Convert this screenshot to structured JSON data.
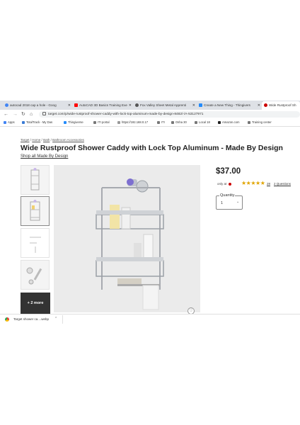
{
  "browser": {
    "tabs": [
      {
        "label": "autocad 2018 cap a hole - Goog",
        "fav_color": "#4285f4",
        "active": false
      },
      {
        "label": "AutoCAD 3D Basics Training Exe",
        "fav_color": "#ff0000",
        "active": false
      },
      {
        "label": "Fox Valley Sheet Metal Apprenti",
        "fav_color": "#555555",
        "active": false
      },
      {
        "label": "Create a New Thing - Thingivers",
        "fav_color": "#248bfb",
        "active": false
      },
      {
        "label": "Wide Rustproof Sh",
        "fav_color": "#cc0000",
        "active": true
      }
    ],
    "url": "target.com/p/wide-rustproof-shower-caddy-with-lock-top-aluminum-made-by-design-8482/-/A-53127971",
    "bookmarks": [
      {
        "label": "Apps",
        "color": "#4285f4"
      },
      {
        "label": "TotalTrack - My Das",
        "color": "#3a7bd5"
      },
      {
        "label": "Thingiverse",
        "color": "#248bfb"
      },
      {
        "label": "ITI portal",
        "color": "#777777"
      },
      {
        "label": "https://192.168.0.17",
        "color": "#999999"
      },
      {
        "label": "ITI",
        "color": "#777777"
      },
      {
        "label": "Osha 30",
        "color": "#777777"
      },
      {
        "label": "Local 18",
        "color": "#777777"
      },
      {
        "label": "Amazon.com",
        "color": "#222222"
      },
      {
        "label": "Training center",
        "color": "#777777"
      }
    ]
  },
  "page": {
    "breadcrumb": [
      "Target",
      "Home",
      "Bath",
      "Bathroom Accessories"
    ],
    "title": "Wide Rustproof Shower Caddy with Lock Top Aluminum - Made By Design",
    "shop_link": "Shop all Made By Design",
    "price": "$37.00",
    "only_at": "only at",
    "rating_value": 4.5,
    "stars": "★★★★★",
    "rating_count": "28",
    "questions": "2 Questions",
    "quantity_label": "Quantity",
    "quantity_value": "1",
    "more_images": "+ 2 more"
  },
  "download": {
    "filename": "Target shower ca....webp"
  },
  "colors": {
    "accent": "#cc0000",
    "star": "#e0a400"
  }
}
